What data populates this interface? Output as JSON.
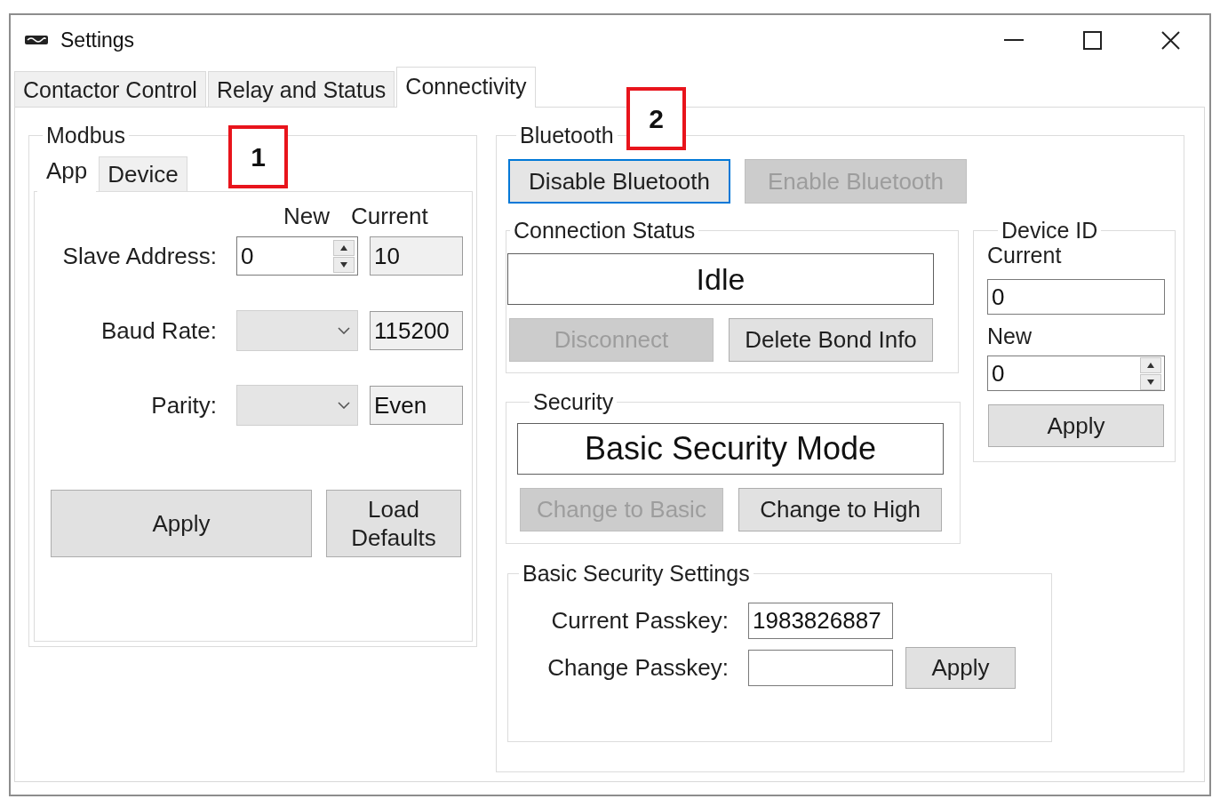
{
  "window": {
    "title": "Settings"
  },
  "tabs": [
    {
      "label": "Contactor Control",
      "selected": false
    },
    {
      "label": "Relay and Status",
      "selected": false
    },
    {
      "label": "Connectivity",
      "selected": true
    }
  ],
  "modbus": {
    "title": "Modbus",
    "callout": "1",
    "tabs": [
      {
        "label": "App",
        "selected": true
      },
      {
        "label": "Device",
        "selected": false
      }
    ],
    "column_headers": [
      "New",
      "Current"
    ],
    "rows": [
      {
        "label": "Slave Address:",
        "kind": "spinner",
        "value": "0",
        "current": "10"
      },
      {
        "label": "Baud Rate:",
        "kind": "dropdown",
        "current": "115200"
      },
      {
        "label": "Parity:",
        "kind": "dropdown",
        "current": "Even"
      }
    ],
    "buttons": [
      {
        "label": "Apply",
        "disabled": false
      },
      {
        "label": "Load Defaults",
        "disabled": false
      }
    ]
  },
  "bluetooth": {
    "title": "Bluetooth",
    "callout": "2",
    "buttons": [
      {
        "label": "Disable Bluetooth",
        "disabled": false,
        "focused": true
      },
      {
        "label": "Enable Bluetooth",
        "disabled": true,
        "focused": false
      }
    ],
    "connection_status": {
      "title": "Connection Status",
      "status": "Idle",
      "buttons": [
        {
          "label": "Disconnect",
          "disabled": true
        },
        {
          "label": "Delete Bond Info",
          "disabled": false
        }
      ]
    },
    "device_id": {
      "title": "Device ID",
      "current_label": "Current",
      "current": "0",
      "new_label": "New",
      "new": "0",
      "button": {
        "label": "Apply",
        "disabled": false
      }
    },
    "security": {
      "title": "Security",
      "mode": "Basic Security Mode",
      "buttons": [
        {
          "label": "Change to Basic",
          "disabled": true
        },
        {
          "label": "Change to High",
          "disabled": false
        }
      ]
    },
    "basic_security_settings": {
      "title": "Basic Security Settings",
      "rows": [
        {
          "label": "Current Passkey:",
          "value": "1983826887"
        },
        {
          "label": "Change Passkey:"
        }
      ],
      "button": {
        "label": "Apply",
        "disabled": false
      }
    }
  }
}
